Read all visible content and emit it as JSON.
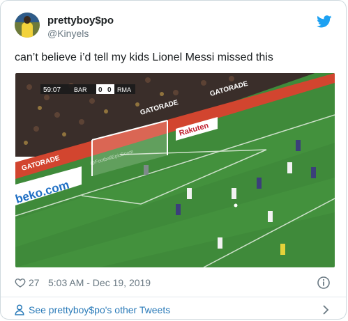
{
  "tweet": {
    "display_name": "prettyboy$po",
    "handle": "@Kinyels",
    "text": "can’t believe i’d tell my kids Lionel Messi missed this",
    "likes": "27",
    "timestamp": "5:03 AM - Dec 19, 2019",
    "more_link": "See prettyboy$po's other Tweets"
  },
  "media": {
    "scoreboard_clock": "59:07",
    "home_team": "BAR",
    "home_score": "0",
    "away_score": "0",
    "away_team": "RMA",
    "ad_gatorade": "GATORADE",
    "ad_rakuten": "Rakuten",
    "ad_beko": "beko.com",
    "watermark": "@FootballEpicBoom"
  },
  "icons": {
    "twitter": "twitter-bird-icon",
    "like": "heart-icon",
    "info": "info-icon",
    "profile": "person-icon",
    "chevron": "chevron-right-icon"
  },
  "colors": {
    "twitter_blue": "#1da1f2",
    "link_blue": "#2b7bb9",
    "secondary_text": "#697882",
    "pitch_green": "#3f8a3a",
    "board_red": "#d2452f"
  }
}
